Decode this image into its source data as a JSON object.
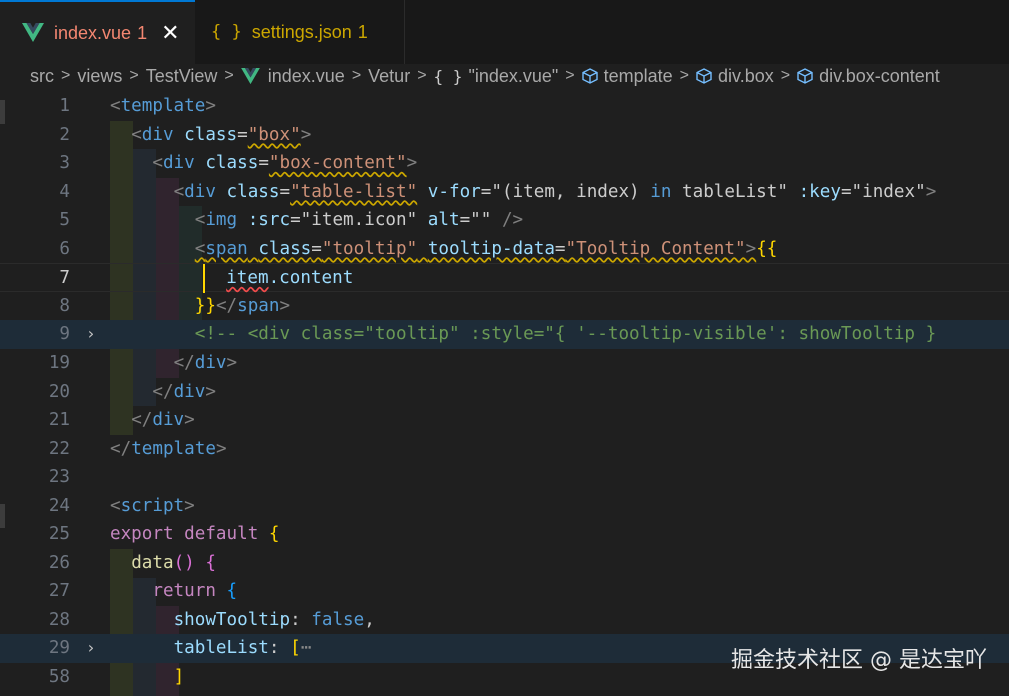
{
  "tabs": [
    {
      "name": "index.vue",
      "count": "1",
      "icon": "vue-icon",
      "active": true
    },
    {
      "name": "settings.json",
      "count": "1",
      "icon": "json-braces-icon",
      "active": false
    }
  ],
  "close_glyph": "✕",
  "json_icon_glyph": "{ }",
  "breadcrumb": [
    {
      "label": "src"
    },
    {
      "label": "views"
    },
    {
      "label": "TestView"
    },
    {
      "label": "index.vue",
      "icon": "vue-icon"
    },
    {
      "label": "Vetur"
    },
    {
      "label": "\"index.vue\"",
      "icon": "json-braces-icon"
    },
    {
      "label": "template",
      "icon": "cube-icon"
    },
    {
      "label": "div.box",
      "icon": "cube-icon"
    },
    {
      "label": "div.box-content",
      "icon": "cube-icon"
    }
  ],
  "separator": ">",
  "line_numbers": [
    "1",
    "2",
    "3",
    "4",
    "5",
    "6",
    "7",
    "8",
    "9",
    "19",
    "20",
    "21",
    "22",
    "23",
    "24",
    "25",
    "26",
    "27",
    "28",
    "29",
    "58"
  ],
  "fold_glyph": "›",
  "code": {
    "l1": [
      "<",
      "template",
      ">"
    ],
    "l2": [
      "<",
      "div",
      "class",
      "=",
      "\"box\"",
      ">"
    ],
    "l3": [
      "<",
      "div",
      "class",
      "=",
      "\"box-content\"",
      ">"
    ],
    "l4": [
      "<",
      "div",
      "class",
      "=",
      "\"table-list\"",
      "v-for",
      "=\"(item, index) ",
      "in",
      " tableList\"",
      ":key",
      "=\"index\"",
      ">"
    ],
    "l5": [
      "<",
      "img",
      ":src",
      "=\"item.icon\"",
      "alt",
      "=\"\"",
      "/>"
    ],
    "l6": [
      "<",
      "span",
      "class",
      "=",
      "\"tooltip\"",
      "tooltip-data",
      "=",
      "\"Tooltip Content\"",
      ">",
      "{{"
    ],
    "l7": [
      "item",
      ".content"
    ],
    "l8": [
      "}}",
      "</",
      "span",
      ">"
    ],
    "l9": "<!-- <div class=\"tooltip\" :style=\"{ '--tooltip-visible': showTooltip }",
    "l19": [
      "</",
      "div",
      ">"
    ],
    "l20": [
      "</",
      "div",
      ">"
    ],
    "l21": [
      "</",
      "div",
      ">"
    ],
    "l22": [
      "</",
      "template",
      ">"
    ],
    "l24": [
      "<",
      "script",
      ">"
    ],
    "l25": [
      "export",
      "default",
      "{"
    ],
    "l26": [
      "data",
      "(",
      ")",
      "{"
    ],
    "l27": [
      "return",
      "{"
    ],
    "l28": [
      "showTooltip",
      ":",
      "false",
      ","
    ],
    "l29": [
      "tableList",
      ":",
      "[",
      "⋯"
    ],
    "l58": [
      "]"
    ]
  },
  "watermark": "掘金技术社区 @ 是达宝吖",
  "colors": {
    "accent": "#0078d4",
    "error": "#f48771",
    "warning": "#cca700"
  }
}
